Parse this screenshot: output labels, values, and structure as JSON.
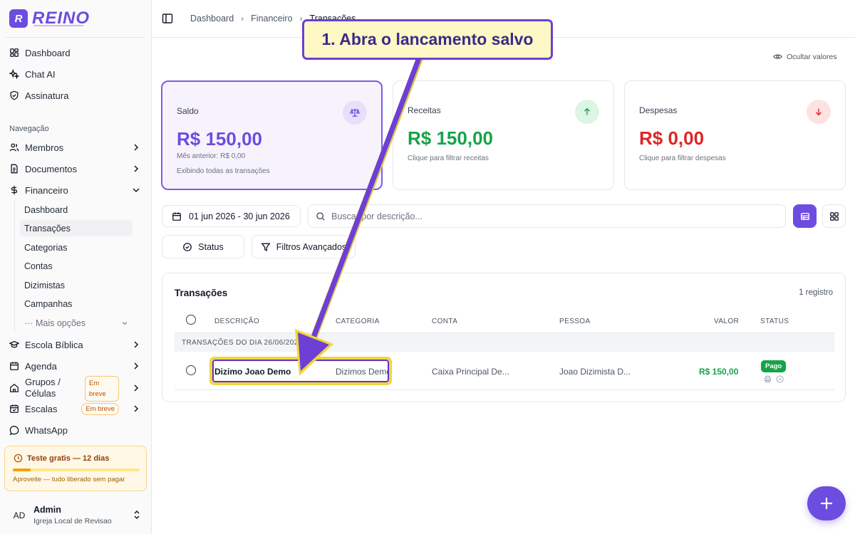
{
  "app": {
    "logo_text": "REINO",
    "logo_mark": "R"
  },
  "sidebar": {
    "top_items": [
      {
        "label": "Dashboard",
        "icon": "dashboard-icon"
      },
      {
        "label": "Chat AI",
        "icon": "sparkles-icon"
      },
      {
        "label": "Assinatura",
        "icon": "shield-icon"
      }
    ],
    "section_label": "Navegação",
    "nav": {
      "membros": "Membros",
      "documentos": "Documentos",
      "financeiro": "Financeiro",
      "escola": "Escola Bíblica",
      "agenda": "Agenda",
      "grupos": "Grupos / Células",
      "escalas": "Escalas",
      "whatsapp": "WhatsApp"
    },
    "soon_badge": "Em breve",
    "financeiro_sub": [
      "Dashboard",
      "Transações",
      "Categorias",
      "Contas",
      "Dizimistas",
      "Campanhas"
    ],
    "more_options": "··· Mais opções",
    "active_sub": "Transações"
  },
  "trial": {
    "title": "Teste gratis — 12 dias",
    "progress": 0.14,
    "note": "Aproveite — tudo liberado sem pagar"
  },
  "user": {
    "initials": "AD",
    "name": "Admin",
    "org": "Igreja Local de Revisao"
  },
  "breadcrumb": {
    "items": [
      "Dashboard",
      "Financeiro"
    ],
    "current": "Transações"
  },
  "hide_values_label": "Ocultar valores",
  "cards": {
    "saldo": {
      "label": "Saldo",
      "value": "R$ 150,00",
      "prev": "Mês anterior: R$ 0,00",
      "note": "Exibindo todas as transações",
      "color": "#6d4ce0"
    },
    "receitas": {
      "label": "Receitas",
      "value": "R$ 150,00",
      "note": "Clique para filtrar receitas",
      "color": "#16a34a"
    },
    "despesas": {
      "label": "Despesas",
      "value": "R$ 0,00",
      "note": "Clique para filtrar despesas",
      "color": "#dc2626"
    }
  },
  "filters": {
    "date_range": "01 jun 2026 - 30 jun 2026",
    "search_placeholder": "Buscar por descrição...",
    "status_label": "Status",
    "advanced_label": "Filtros Avançados"
  },
  "table": {
    "title": "Transações",
    "count": "1 registro",
    "headers": {
      "descricao": "DESCRIÇÃO",
      "categoria": "CATEGORIA",
      "conta": "CONTA",
      "pessoa": "PESSOA",
      "valor": "VALOR",
      "status": "STATUS"
    },
    "group_label": "TRANSAÇÕES DO DIA 26/06/2026",
    "rows": [
      {
        "descricao": "Dizimo Joao Demo",
        "categoria": "Dizimos Demo",
        "conta": "Caixa Principal De...",
        "pessoa": "Joao Dizimista D...",
        "valor": "R$ 150,00",
        "status": "Pago"
      }
    ]
  },
  "annotation": {
    "callout": "1. Abra o lancamento salvo"
  }
}
